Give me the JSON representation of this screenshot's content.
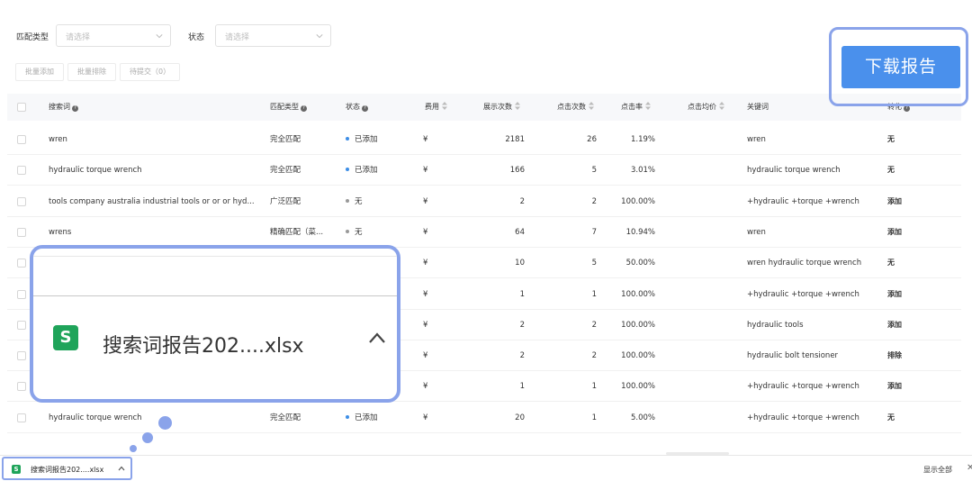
{
  "filters": {
    "match_type_label": "匹配类型",
    "match_type_placeholder": "请选择",
    "status_label": "状态",
    "status_placeholder": "请选择"
  },
  "actions": {
    "batch_add": "批量添加",
    "batch_exclude": "批量排除",
    "pending": "待提交（0）"
  },
  "table": {
    "headers": [
      "搜索词",
      "匹配类型",
      "状态",
      "费用",
      "展示次数",
      "点击次数",
      "点击率",
      "点击均价",
      "关键词",
      "转化"
    ],
    "rows": [
      {
        "term": "wren",
        "match": "完全匹配",
        "status": "已添加",
        "status_color": "#3d8ee6",
        "cost": "¥",
        "impr": "2181",
        "clicks": "26",
        "ctr": "1.19%",
        "cpc": "",
        "keyword": "wren",
        "action": "无"
      },
      {
        "term": "hydraulic torque wrench",
        "match": "完全匹配",
        "status": "已添加",
        "status_color": "#3d8ee6",
        "cost": "¥",
        "impr": "166",
        "clicks": "5",
        "ctr": "3.01%",
        "cpc": "",
        "keyword": "hydraulic torque wrench",
        "action": "无"
      },
      {
        "term": "tools company australia industrial tools or or or hyd...",
        "match": "广泛匹配",
        "status": "无",
        "status_color": "#999999",
        "cost": "¥",
        "impr": "2",
        "clicks": "2",
        "ctr": "100.00%",
        "cpc": "",
        "keyword": "+hydraulic +torque +wrench",
        "action": "添加"
      },
      {
        "term": "wrens",
        "match": "精确匹配（菜...",
        "status": "无",
        "status_color": "#999999",
        "cost": "¥",
        "impr": "64",
        "clicks": "7",
        "ctr": "10.94%",
        "cpc": "",
        "keyword": "wren",
        "action": "添加"
      },
      {
        "term": "",
        "match": "",
        "status": "",
        "status_color": "",
        "cost": "¥",
        "impr": "10",
        "clicks": "5",
        "ctr": "50.00%",
        "cpc": "",
        "keyword": "wren hydraulic torque wrench",
        "action": "无"
      },
      {
        "term": "",
        "match": "",
        "status": "",
        "status_color": "",
        "cost": "¥",
        "impr": "1",
        "clicks": "1",
        "ctr": "100.00%",
        "cpc": "",
        "keyword": "+hydraulic +torque +wrench",
        "action": "添加"
      },
      {
        "term": "",
        "match": "",
        "status": "",
        "status_color": "",
        "cost": "¥",
        "impr": "2",
        "clicks": "2",
        "ctr": "100.00%",
        "cpc": "",
        "keyword": "hydraulic tools",
        "action": "添加"
      },
      {
        "term": "",
        "match": "",
        "status": "",
        "status_color": "",
        "cost": "¥",
        "impr": "2",
        "clicks": "2",
        "ctr": "100.00%",
        "cpc": "",
        "keyword": "hydraulic bolt tensioner",
        "action": "排除"
      },
      {
        "term": "",
        "match": "",
        "status": "",
        "status_color": "",
        "cost": "¥",
        "impr": "1",
        "clicks": "1",
        "ctr": "100.00%",
        "cpc": "",
        "keyword": "+hydraulic +torque +wrench",
        "action": "添加"
      },
      {
        "term": "hydraulic torque wrench",
        "match": "完全匹配",
        "status": "已添加",
        "status_color": "#3d8ee6",
        "cost": "¥",
        "impr": "20",
        "clicks": "1",
        "ctr": "5.00%",
        "cpc": "",
        "keyword": "+hydraulic +torque +wrench",
        "action": "无"
      }
    ]
  },
  "download_report_button": "下载报告",
  "download_bar": {
    "file_icon": "S",
    "file_name": "搜索词报告202....xlsx",
    "show_all": "显示全部",
    "close": "✕"
  },
  "zoom": {
    "file_icon": "S",
    "file_name": "搜索词报告202....xlsx"
  },
  "colors": {
    "accent": "#4a90ec",
    "highlight": "#8aa3ea",
    "excel_green": "#1fa45a"
  }
}
